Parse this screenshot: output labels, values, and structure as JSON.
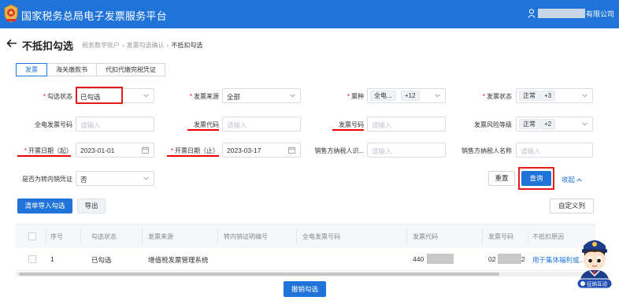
{
  "header": {
    "app_title": "国家税务总局电子发票服务平台",
    "user_company_suffix": "有限公司",
    "brand_color": "#1f73d9"
  },
  "breadcrumb": {
    "page_title": "不抵扣勾选",
    "crumbs": [
      "税务数字账户",
      "发票勾选确认",
      "不抵扣勾选"
    ]
  },
  "tabs": [
    "发票",
    "海关缴款书",
    "代扣代缴完税凭证"
  ],
  "form": {
    "check_status": {
      "label": "勾选状态",
      "value": "已勾选"
    },
    "invoice_source": {
      "label": "发票来源",
      "value": "全部"
    },
    "invoice_type": {
      "label": "票种",
      "tag": "全电...",
      "more": "+12"
    },
    "invoice_status": {
      "label": "发票状态",
      "tag": "正常",
      "more": "+3"
    },
    "full_elec_no": {
      "label": "全电发票号码",
      "placeholder": "请输入"
    },
    "invoice_code": {
      "label": "发票代码",
      "placeholder": "请输入"
    },
    "invoice_no": {
      "label": "发票号码",
      "placeholder": "请输入"
    },
    "risk_level": {
      "label": "发票风险等级",
      "tag": "正常",
      "more": "+2"
    },
    "date_start": {
      "label": "开票日期（起）",
      "value": "2023-01-01"
    },
    "date_end": {
      "label": "开票日期（止）",
      "value": "2023-03-17"
    },
    "seller_tax_id": {
      "label": "销售方纳税人识...",
      "placeholder": "请输入"
    },
    "seller_name": {
      "label": "销售方纳税人名称",
      "placeholder": "请输入"
    },
    "transfer_out": {
      "label": "是否为转内销凭证",
      "value": "否"
    }
  },
  "actions": {
    "reset": "重置",
    "query": "查询",
    "collapse": "收起",
    "import_check": "清单导入勾选",
    "export": "导出",
    "custom_columns": "自定义列",
    "cancel_check": "撤销勾选"
  },
  "table": {
    "columns": [
      "序号",
      "勾选状态",
      "发票来源",
      "转内销证明编号",
      "全电发票号码",
      "发票代码",
      "发票号码",
      "不抵扣原因"
    ],
    "rows": [
      {
        "index": "1",
        "status": "已勾选",
        "source": "增值税发票管理系统",
        "code_prefix": "440",
        "number_prefix": "02",
        "number_suffix": "2",
        "reason": "用于集体福利或..."
      }
    ]
  },
  "mascot": {
    "caption": "征纳互动"
  }
}
